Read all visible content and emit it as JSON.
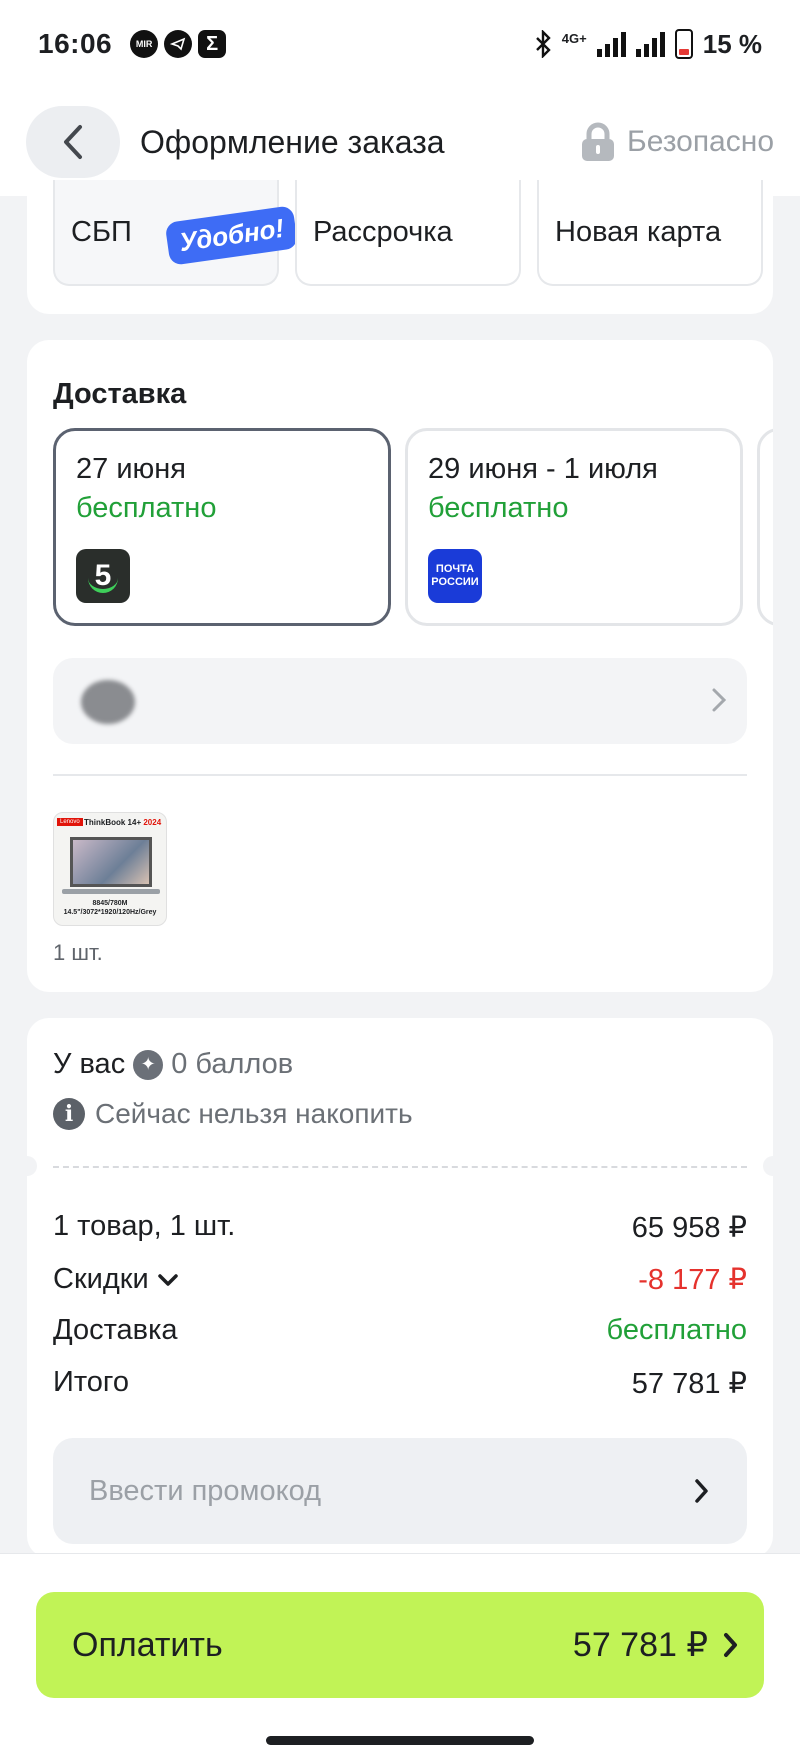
{
  "status_bar": {
    "time": "16:06",
    "app_icons": [
      "mir-icon",
      "telegram-icon",
      "sigma-icon"
    ],
    "network": "4G+",
    "battery": "15 %"
  },
  "header": {
    "title": "Оформление заказа",
    "secure_label": "Безопасно"
  },
  "payment": {
    "options": [
      {
        "label": "СБП",
        "badge": "Удобно!"
      },
      {
        "label": "Рассрочка"
      },
      {
        "label": "Новая карта"
      }
    ]
  },
  "delivery": {
    "title": "Доставка",
    "options": [
      {
        "date": "27 июня",
        "price": "бесплатно",
        "logo": "5",
        "selected": true
      },
      {
        "date": "29 июня - 1 июля",
        "price": "бесплатно",
        "logo": "ПОЧТА РОССИИ",
        "selected": false
      }
    ],
    "product": {
      "brand": "Lenovo",
      "model": "ThinkBook 14+",
      "year": "2024",
      "specs_1": "8845/780M",
      "specs_2": "14.5\"/3072*1920/120Hz/Grey",
      "quantity": "1 шт."
    }
  },
  "summary": {
    "points_prefix": "У вас",
    "points_value": "0 баллов",
    "points_notice": "Сейчас нельзя накопить",
    "rows": [
      {
        "label": "1 товар, 1 шт.",
        "value": "65 958 ₽"
      },
      {
        "label": "Скидки",
        "value": "-8 177 ₽"
      },
      {
        "label": "Доставка",
        "value": "бесплатно"
      },
      {
        "label": "Итого",
        "value": "57 781 ₽"
      }
    ],
    "promo_placeholder": "Ввести промокод"
  },
  "checkout": {
    "pay_label": "Оплатить",
    "amount": "57 781 ₽"
  },
  "colors": {
    "accent_green": "#c1f356",
    "free_green": "#21a038",
    "discount_red": "#e5322d",
    "badge_blue": "#3e6cf5"
  }
}
